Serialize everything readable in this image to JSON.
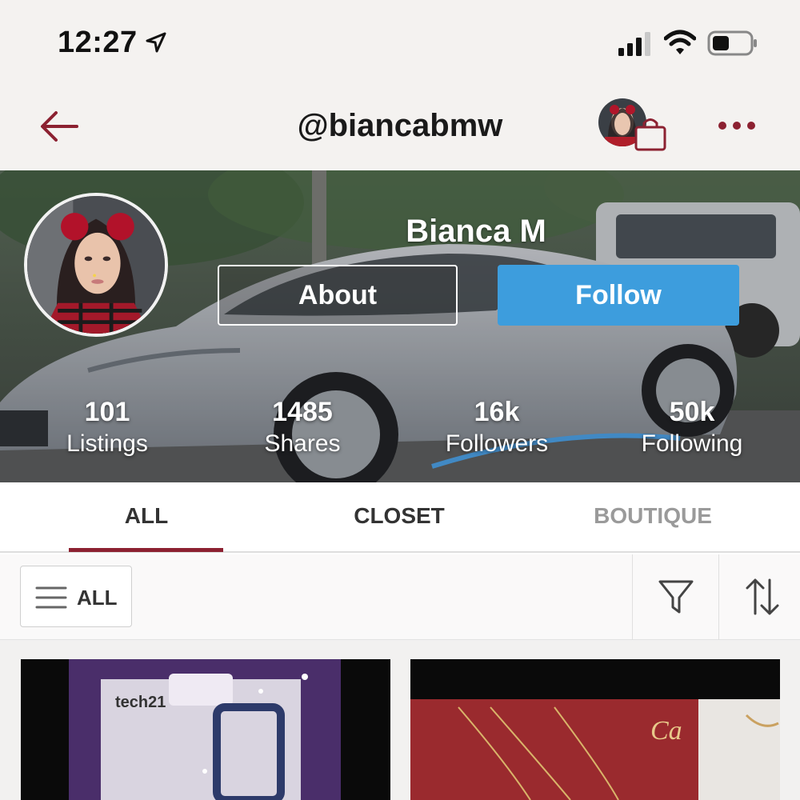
{
  "status_bar": {
    "time": "12:27",
    "icons": [
      "location-arrow-icon",
      "cellular-signal-icon",
      "wifi-icon",
      "battery-icon"
    ]
  },
  "nav": {
    "title": "@biancabmw",
    "icons": [
      "back-arrow-icon",
      "avatar",
      "shopping-bag-icon",
      "more-dots-icon"
    ],
    "accent_color": "#8c2131"
  },
  "profile": {
    "name": "Bianca M",
    "about_label": "About",
    "follow_label": "Follow",
    "follow_color": "#3d9ddd",
    "stats": [
      {
        "value": "101",
        "label": "Listings"
      },
      {
        "value": "1485",
        "label": "Shares"
      },
      {
        "value": "16k",
        "label": "Followers"
      },
      {
        "value": "50k",
        "label": "Following"
      }
    ]
  },
  "tabs": [
    {
      "label": "ALL",
      "active": true
    },
    {
      "label": "CLOSET",
      "active": false
    },
    {
      "label": "BOUTIQUE",
      "active": false
    }
  ],
  "filter": {
    "all_label": "ALL",
    "icons": [
      "menu-icon",
      "filter-funnel-icon",
      "sort-arrows-icon"
    ]
  },
  "listings": [
    {
      "image_text": "tech21"
    },
    {
      "image_text": "Ca"
    }
  ]
}
